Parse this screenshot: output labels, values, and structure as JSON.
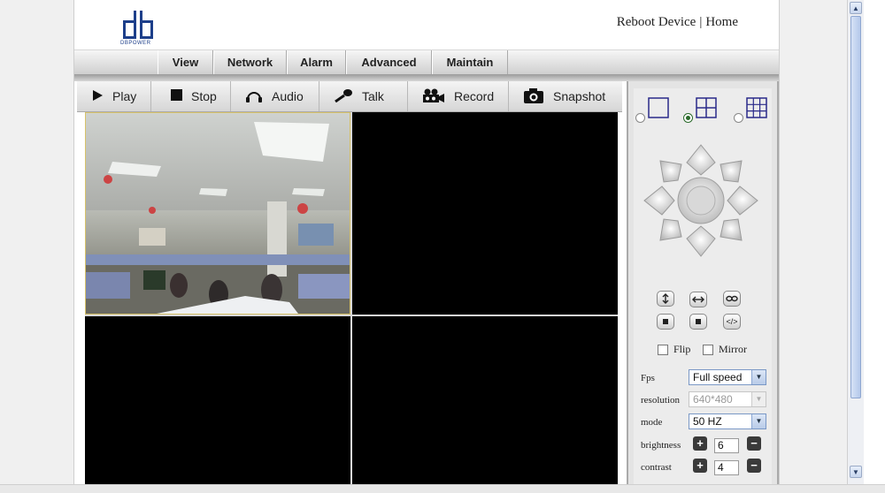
{
  "header": {
    "logo_text": "DBPOWER",
    "links": {
      "reboot": "Reboot Device",
      "separator": "|",
      "home": "Home"
    }
  },
  "nav": {
    "tabs": [
      "View",
      "Network",
      "Alarm",
      "Advanced",
      "Maintain"
    ]
  },
  "toolbar": {
    "play": "Play",
    "stop": "Stop",
    "audio": "Audio",
    "talk": "Talk",
    "record": "Record",
    "snapshot": "Snapshot"
  },
  "layout_options": {
    "selected": "quad"
  },
  "controls": {
    "flip_label": "Flip",
    "mirror_label": "Mirror",
    "pattern_label": "</>"
  },
  "settings": {
    "fps": {
      "label": "Fps",
      "value": "Full speed"
    },
    "resolution": {
      "label": "resolution",
      "value": "640*480"
    },
    "mode": {
      "label": "mode",
      "value": "50 HZ"
    },
    "brightness": {
      "label": "brightness",
      "value": "6"
    },
    "contrast": {
      "label": "contrast",
      "value": "4"
    }
  },
  "colors": {
    "accent_blue": "#1d3f8a",
    "selected_frame": "#d8c36a",
    "video_bg": "#000000"
  }
}
